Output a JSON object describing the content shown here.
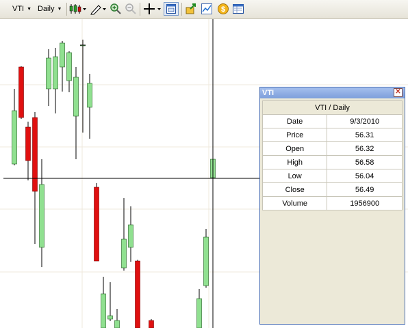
{
  "toolbar": {
    "symbol": "VTI",
    "period": "Daily",
    "icons": [
      "candlestick-icon",
      "draw-pen-icon",
      "zoom-in-icon",
      "zoom-out-icon",
      "crosshair-icon",
      "data-window-icon",
      "export-icon",
      "chart-line-icon",
      "dollar-icon",
      "table-icon"
    ]
  },
  "panel": {
    "title": "VTI",
    "heading": "VTI / Daily",
    "rows": [
      {
        "label": "Date",
        "value": "9/3/2010"
      },
      {
        "label": "Price",
        "value": "56.31"
      },
      {
        "label": "Open",
        "value": "56.32"
      },
      {
        "label": "High",
        "value": "56.58"
      },
      {
        "label": "Low",
        "value": "56.04"
      },
      {
        "label": "Close",
        "value": "56.49"
      },
      {
        "label": "Volume",
        "value": "1956900"
      }
    ]
  },
  "colors": {
    "up": "#90e090",
    "down": "#e01010",
    "grid": "#efe8dc",
    "crosshair": "#000000"
  }
}
